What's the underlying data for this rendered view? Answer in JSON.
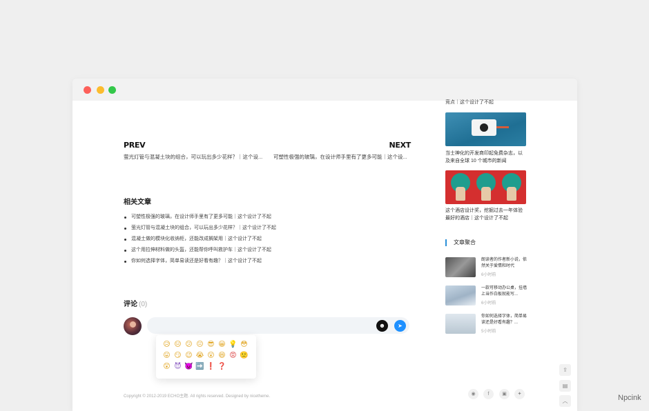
{
  "post_nav": {
    "prev_label": "PREV",
    "prev_text": "萤光灯管与混凝土块的组合，可以玩出多少花样？｜这个设...",
    "next_label": "NEXT",
    "next_text": "可塑性极强的玻璃，在设计师手里有了更多可能｜这个设..."
  },
  "related": {
    "heading": "相关文章",
    "items": [
      "可塑性极强的玻璃，在设计师手里有了更多可能｜这个设计了不起",
      "萤光灯管与混凝土块的组合，可以玩出多少花样？｜这个设计了不起",
      "混凝土做的模块化收纳柜，还能改成搁架用｜这个设计了不起",
      "这个用拉伸材料做的头盔，还能帮你呼叫救护车｜这个设计了不起",
      "你如何选择字体，简单易读还是好看有趣？｜这个设计了不起"
    ]
  },
  "comments": {
    "heading": "评论",
    "count": "(0)",
    "emoji_rows": [
      [
        "😥",
        "😑",
        "😕",
        "😐",
        "😎",
        "😀",
        "💡",
        "😳"
      ],
      [
        "😛",
        "😏",
        "😉",
        "😭",
        "😮",
        "😆",
        "😡",
        "🙁"
      ],
      [
        "😲",
        "😈",
        "👿",
        "➡️",
        "❗",
        "❓"
      ]
    ]
  },
  "footer": {
    "copyright": "Copyright © 2012-2019 ECHO主题. All rights reserved. Designed by nicetheme."
  },
  "sidebar": {
    "top_text": "竞点｜这个设计了不起",
    "features": [
      {
        "text": "当士神化的开发商印起免费杂志，以及来自全球 10 个城市的新闻"
      },
      {
        "text": "这个酒店设计奖，挖掘过去一年体验最好的酒店｜这个设计了不起"
      }
    ],
    "aggregation": {
      "heading": "文章聚合",
      "items": [
        {
          "title": "朗读者的作者新小说，依然关于爱情和时代",
          "time": "6小时前"
        },
        {
          "title": "一款可移动办公桌，挂墙上当作白板就能写...",
          "time": "6小时前"
        },
        {
          "title": "你如何选择字体，简单易读还是好看有趣？...",
          "time": "5小时前"
        }
      ]
    }
  },
  "watermark": "Npcink",
  "colors": {
    "accent": "#2a8fd8",
    "send": "#1e90ff"
  }
}
